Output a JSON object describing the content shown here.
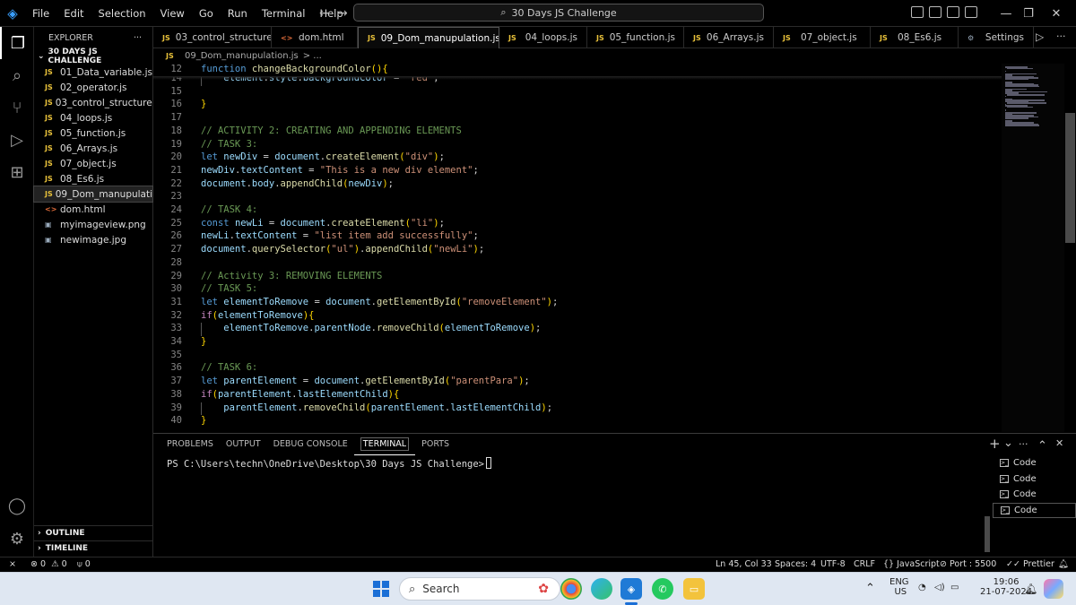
{
  "menu": [
    "File",
    "Edit",
    "Selection",
    "View",
    "Go",
    "Run",
    "Terminal",
    "Help"
  ],
  "command_center": "30 Days JS Challenge",
  "explorer": {
    "title": "EXPLORER",
    "more": "···",
    "folder": "30 DAYS JS CHALLENGE",
    "files": [
      {
        "type": "JS",
        "name": "01_Data_variable.js"
      },
      {
        "type": "JS",
        "name": "02_operator.js"
      },
      {
        "type": "JS",
        "name": "03_control_structure.js"
      },
      {
        "type": "JS",
        "name": "04_loops.js"
      },
      {
        "type": "JS",
        "name": "05_function.js"
      },
      {
        "type": "JS",
        "name": "06_Arrays.js"
      },
      {
        "type": "JS",
        "name": "07_object.js"
      },
      {
        "type": "JS",
        "name": "08_Es6.js"
      },
      {
        "type": "JS",
        "name": "09_Dom_manupulatio..."
      },
      {
        "type": "<>",
        "name": "dom.html"
      },
      {
        "type": "▣",
        "name": "myimageview.png"
      },
      {
        "type": "▣",
        "name": "newimage.jpg"
      }
    ],
    "outline": "OUTLINE",
    "timeline": "TIMELINE"
  },
  "tabs": [
    {
      "type": "JS",
      "name": "03_control_structure.js"
    },
    {
      "type": "<>",
      "name": "dom.html"
    },
    {
      "type": "JS",
      "name": "09_Dom_manupulation.js"
    },
    {
      "type": "JS",
      "name": "04_loops.js"
    },
    {
      "type": "JS",
      "name": "05_function.js"
    },
    {
      "type": "JS",
      "name": "06_Arrays.js"
    },
    {
      "type": "JS",
      "name": "07_object.js"
    },
    {
      "type": "JS",
      "name": "08_Es6.js"
    },
    {
      "type": "⚙",
      "name": "Settings"
    }
  ],
  "breadcrumb": {
    "badge": "JS",
    "file": "09_Dom_manupulation.js",
    "rest": "> ..."
  },
  "code": {
    "sticky": {
      "ln": "12",
      "text": "function changeBackgroundColor(){"
    },
    "lines": [
      {
        "ln": "14",
        "text": "    element.style.backgroundColor = \"red\";"
      },
      {
        "ln": "15",
        "text": ""
      },
      {
        "ln": "16",
        "text": "}"
      },
      {
        "ln": "17",
        "text": ""
      },
      {
        "ln": "18",
        "text": "// ACTIVITY 2: CREATING AND APPENDING ELEMENTS"
      },
      {
        "ln": "19",
        "text": "// TASK 3:"
      },
      {
        "ln": "20",
        "text": "let newDiv = document.createElement(\"div\");"
      },
      {
        "ln": "21",
        "text": "newDiv.textContent = \"This is a new div element\";"
      },
      {
        "ln": "22",
        "text": "document.body.appendChild(newDiv);"
      },
      {
        "ln": "23",
        "text": ""
      },
      {
        "ln": "24",
        "text": "// TASK 4:"
      },
      {
        "ln": "25",
        "text": "const newLi = document.createElement(\"li\");"
      },
      {
        "ln": "26",
        "text": "newLi.textContent = \"list item add successfully\";"
      },
      {
        "ln": "27",
        "text": "document.querySelector(\"ul\").appendChild(\"newLi\");"
      },
      {
        "ln": "28",
        "text": ""
      },
      {
        "ln": "29",
        "text": "// Activity 3: REMOVING ELEMENTS"
      },
      {
        "ln": "30",
        "text": "// TASK 5:"
      },
      {
        "ln": "31",
        "text": "let elementToRemove = document.getElementById(\"removeElement\");"
      },
      {
        "ln": "32",
        "text": "if(elementToRemove){"
      },
      {
        "ln": "33",
        "text": "    elementToRemove.parentNode.removeChild(elementToRemove);"
      },
      {
        "ln": "34",
        "text": "}"
      },
      {
        "ln": "35",
        "text": ""
      },
      {
        "ln": "36",
        "text": "// TASK 6:"
      },
      {
        "ln": "37",
        "text": "let parentElement = document.getElementById(\"parentPara\");"
      },
      {
        "ln": "38",
        "text": "if(parentElement.lastElementChild){"
      },
      {
        "ln": "39",
        "text": "    parentElement.removeChild(parentElement.lastElementChild);"
      },
      {
        "ln": "40",
        "text": "}"
      }
    ]
  },
  "panel": {
    "tabs": [
      "PROBLEMS",
      "OUTPUT",
      "DEBUG CONSOLE",
      "TERMINAL",
      "PORTS"
    ],
    "prompt": "PS C:\\Users\\techn\\OneDrive\\Desktop\\30 Days JS Challenge>",
    "terminals": [
      "Code",
      "Code",
      "Code",
      "Code"
    ],
    "actions": {
      "add": "+",
      "dropdown": "⌄",
      "more": "···",
      "maximize": "⌃",
      "close": "✕"
    }
  },
  "status": {
    "remote": "⨯",
    "errors": "0",
    "warnings": "0",
    "ports_fwd": "0",
    "position": "Ln 45, Col 33",
    "spaces": "Spaces: 4",
    "encoding": "UTF-8",
    "eol": "CRLF",
    "language": "JavaScript",
    "port": "Port : 5500",
    "prettier": "Prettier"
  },
  "taskbar": {
    "search": "Search",
    "lang1": "ENG",
    "lang2": "US",
    "time": "19:06",
    "date": "21-07-2024"
  },
  "colors": {
    "keyword": "#569cd6",
    "function": "#dcdcaa",
    "variable": "#9cdcfe",
    "string": "#ce9178",
    "comment": "#6a9955",
    "control": "#c586c0",
    "bracket1": "#ffd700",
    "bracket2": "#da70d6",
    "bracket3": "#179fff"
  }
}
